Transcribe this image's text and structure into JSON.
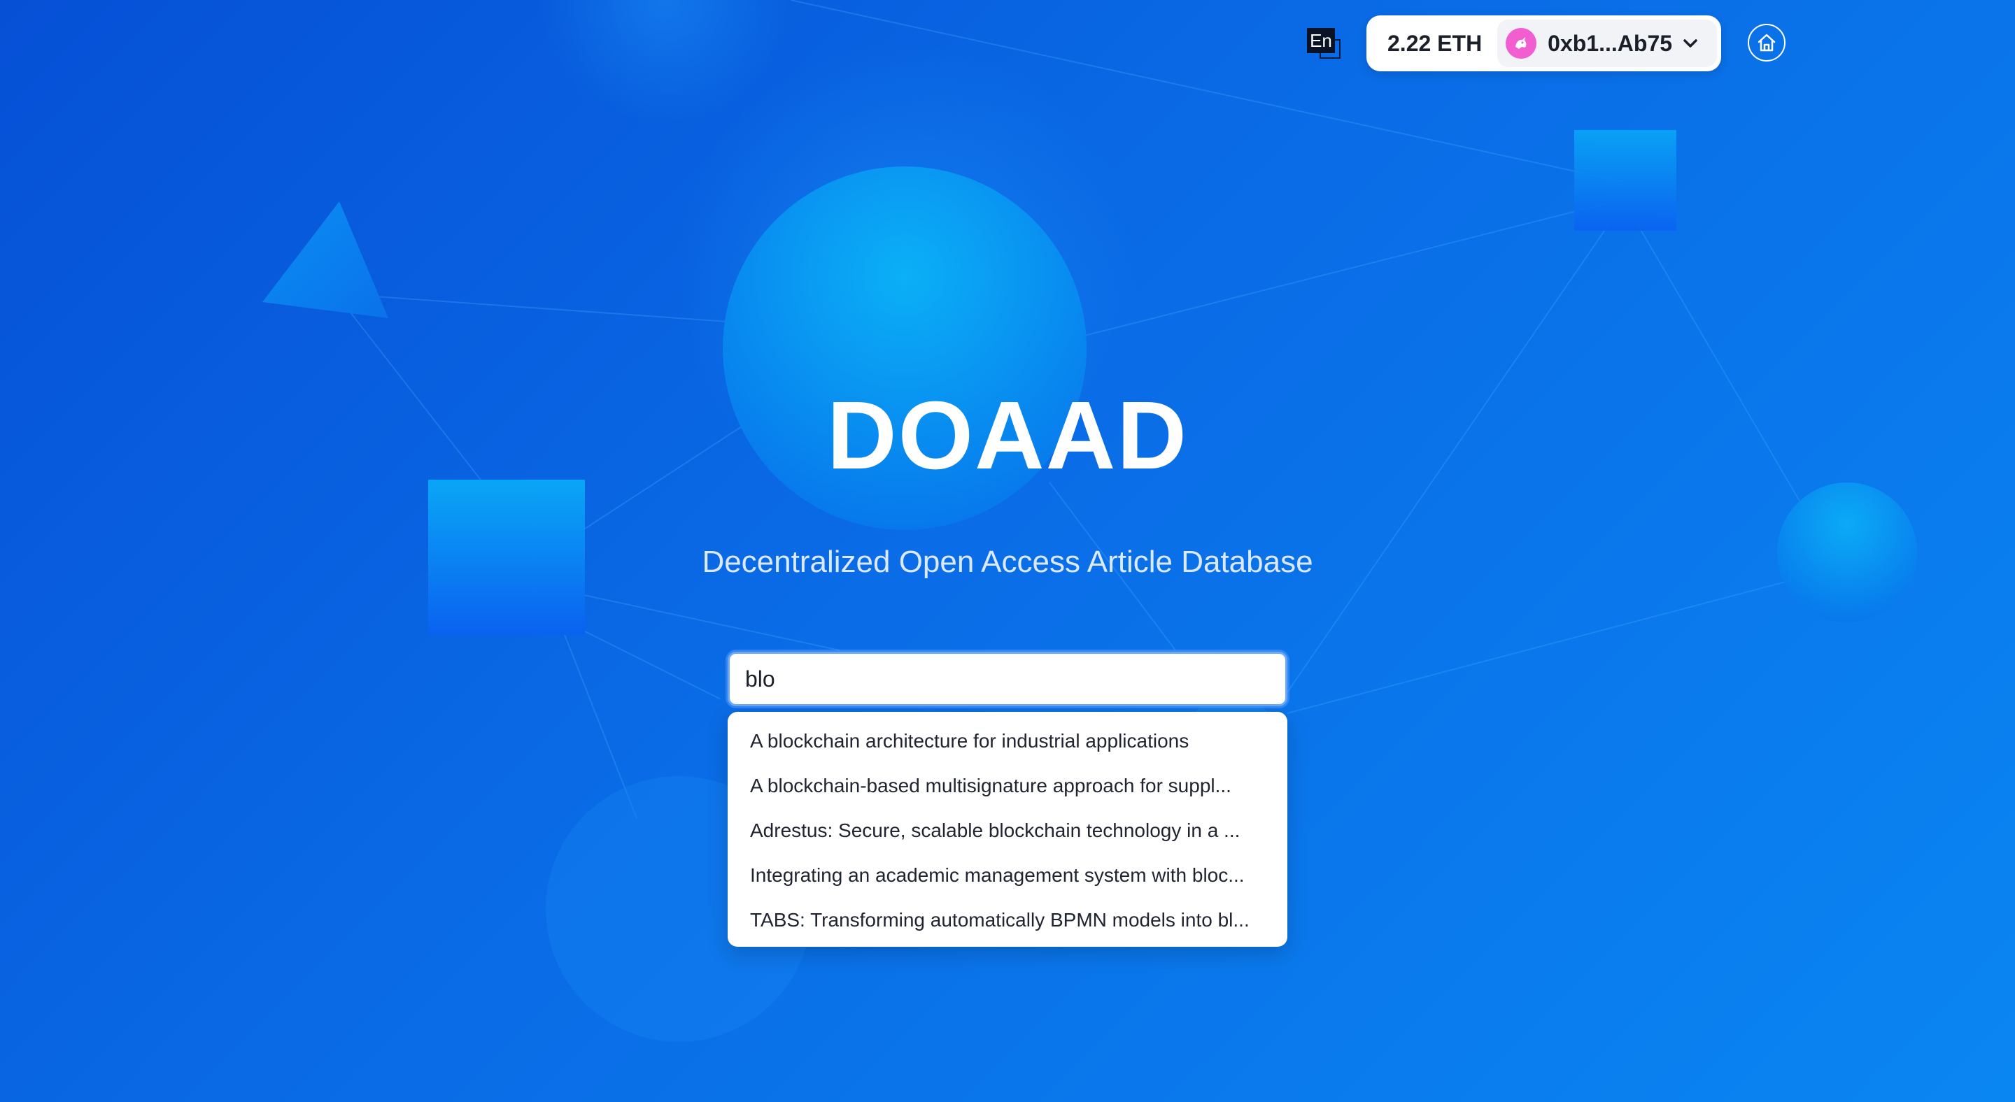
{
  "header": {
    "language_button": "En",
    "wallet": {
      "balance": "2.22 ETH",
      "address": "0xb1...Ab75"
    },
    "home_icon": "home-icon"
  },
  "hero": {
    "title": "DOAAD",
    "subtitle": "Decentralized Open Access Article Database"
  },
  "search": {
    "value": "blo",
    "suggestions": [
      "A blockchain architecture for industrial applications",
      "A blockchain-based multisignature approach for suppl...",
      "Adrestus: Secure, scalable blockchain technology in a ...",
      "Integrating an academic management system with bloc...",
      "TABS: Transforming automatically BPMN models into bl..."
    ]
  },
  "colors": {
    "background_start": "#0650d6",
    "background_end": "#0a86f2",
    "avatar": "#f25ecf",
    "search_focus_border": "#6aa8ff"
  }
}
